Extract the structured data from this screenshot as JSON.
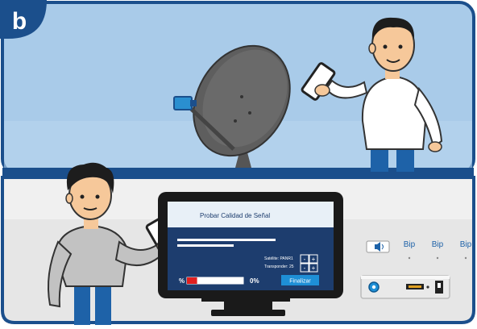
{
  "panel_letter": "b",
  "tv_screen": {
    "title": "Probar Calidad de Señal",
    "satellite_label": "Satélite: PANR1",
    "transponder_label": "Transponder: 25",
    "minus": "-",
    "plus": "+",
    "quality_prefix": "%",
    "quality_value": "0%",
    "quality_fill": 0.18,
    "finish_button": "Finalizar"
  },
  "beeps": [
    "Bip",
    "Bip",
    "Bip"
  ],
  "colors": {
    "border": "#1b4f8c",
    "sky": "#a9cbe9",
    "floor": "#e6e6e6",
    "tv_screen": "#1d3d6e",
    "accent_blue": "#1e8fd6",
    "quality_red": "#e02020"
  }
}
